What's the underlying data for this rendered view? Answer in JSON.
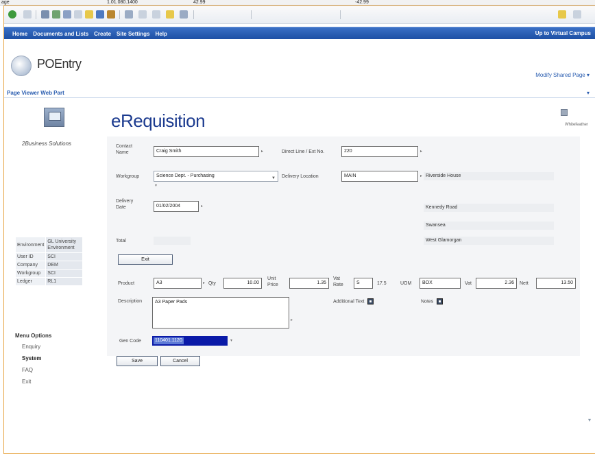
{
  "excel_strip": {
    "cell_ref": "age",
    "value1": "1.01.080.1400",
    "value2": "42.99",
    "value3": "-42.99"
  },
  "navbar": {
    "items": [
      "Home",
      "Documents and Lists",
      "Create",
      "Site Settings",
      "Help"
    ],
    "right_link": "Up to Virtual Campus"
  },
  "site": {
    "title": "POEntry",
    "modify_link": "Modify Shared Page ▾"
  },
  "webpart": {
    "title": "Page Viewer Web Part"
  },
  "sidebar": {
    "brand": "2Business Solutions",
    "env": [
      {
        "key": "Environment",
        "value": "GL University Environment"
      },
      {
        "key": "User ID",
        "value": "SCI"
      },
      {
        "key": "Company",
        "value": "DEM"
      },
      {
        "key": "Workgroup",
        "value": "SCI"
      },
      {
        "key": "Ledger",
        "value": "RL1"
      }
    ],
    "menu_title": "Menu Options",
    "menu_items": [
      "Enquiry",
      "System",
      "FAQ",
      "Exit"
    ]
  },
  "main": {
    "heading": "eRequisition",
    "download_label": "Whitefeather"
  },
  "form": {
    "contact_label": "Contact Name",
    "contact_value": "Craig Smith",
    "direct_line_label": "Direct Line / Ext No.",
    "direct_line_value": "220",
    "workgroup_label": "Workgroup",
    "workgroup_value": "Science Dept. - Purchasing",
    "delivery_location_label": "Delivery Location",
    "delivery_location_value": "MAIN",
    "address_1": "Riverside House",
    "delivery_date_label": "Delivery Date",
    "delivery_date_value": "01/02/2004",
    "address_2": "Kennedy Road",
    "address_3": "Swansea",
    "address_4": "West Glamorgan",
    "total_label": "Total",
    "exit_label": "Exit",
    "product_label": "Product",
    "product_value": "A3",
    "qty_label": "Qty",
    "qty_value": "10.00",
    "unit_price_label": "Unit Price",
    "unit_price_value": "1.35",
    "vat_rate_label": "Vat Rate",
    "vat_rate_value": "S",
    "vat_rate_pct": "17.5",
    "uom_label": "UOM",
    "uom_value": "BOX",
    "vat_label": "Vat",
    "vat_value": "2.36",
    "nett_label": "Nett",
    "nett_value": "13.50",
    "description_label": "Description",
    "description_value": "A3 Paper Pads",
    "additional_text_label": "Additional Text",
    "notes_label": "Notes",
    "gen_code_label": "Gen Code",
    "gen_code_value": "110401.1120",
    "save_label": "Save",
    "cancel_label": "Cancel"
  }
}
